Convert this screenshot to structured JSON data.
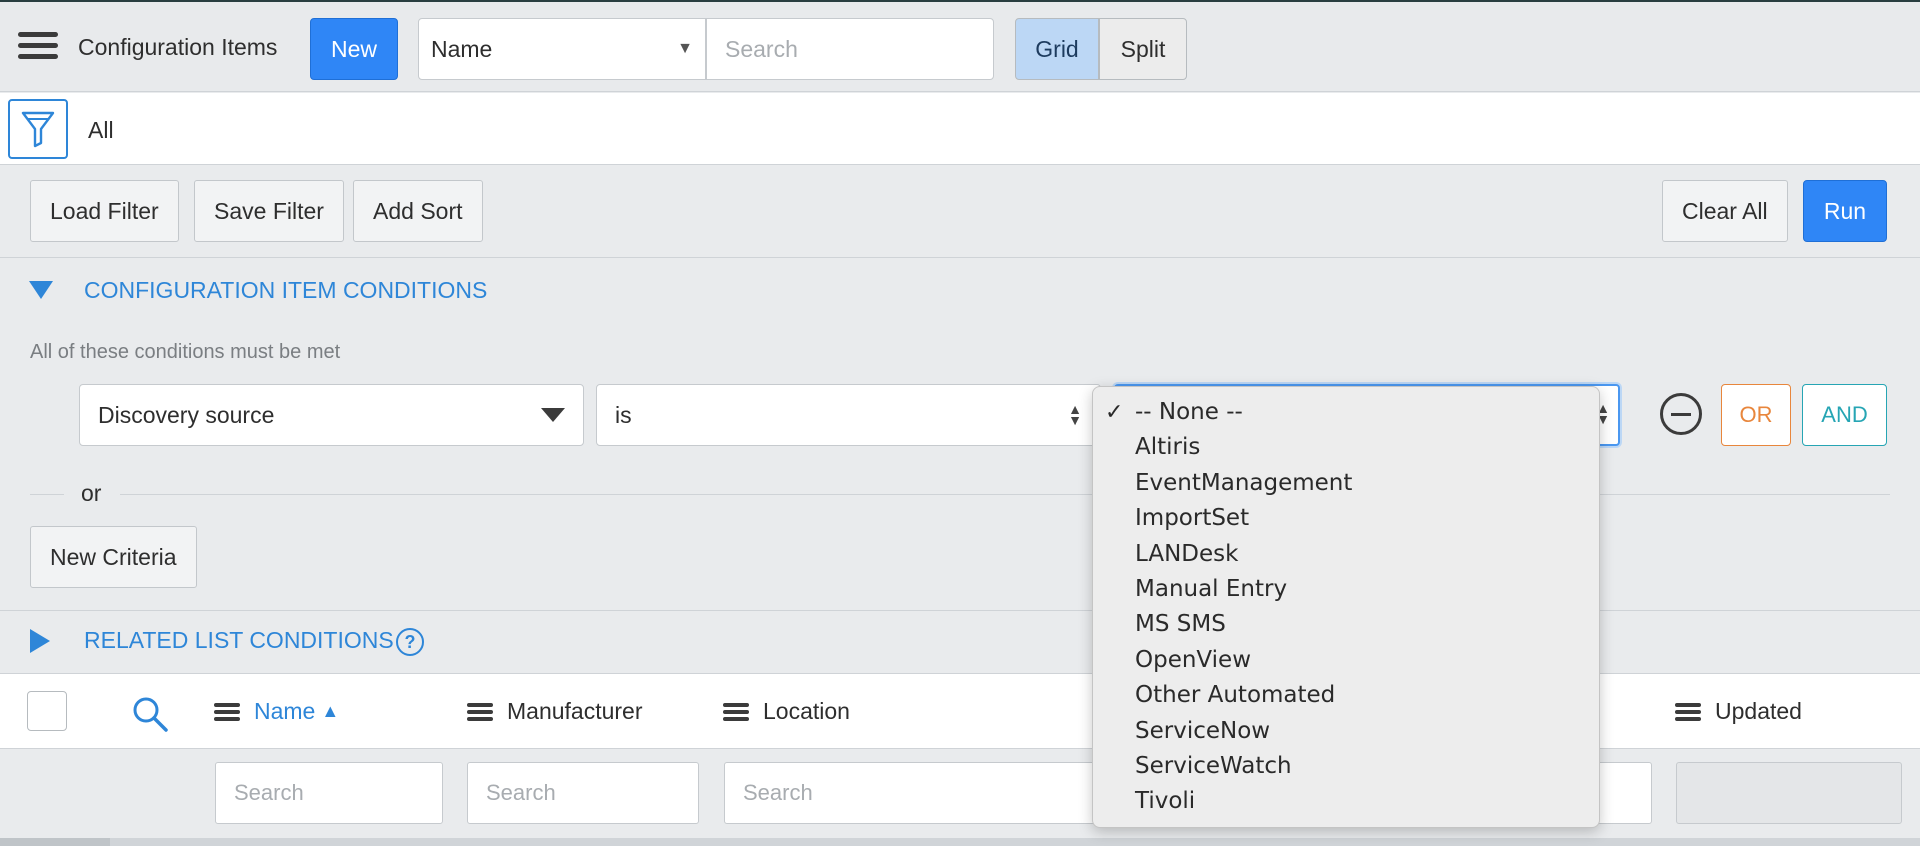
{
  "header": {
    "title": "Configuration Items",
    "new_label": "New",
    "search_field": "Name",
    "search_placeholder": "Search",
    "view_grid": "Grid",
    "view_split": "Split"
  },
  "breadcrumb": "All",
  "actions": {
    "load_filter": "Load Filter",
    "save_filter": "Save Filter",
    "add_sort": "Add Sort",
    "clear_all": "Clear All",
    "run": "Run"
  },
  "conditions": {
    "title": "CONFIGURATION ITEM CONDITIONS",
    "note": "All of these conditions must be met",
    "field": "Discovery source",
    "operator": "is",
    "or_btn": "OR",
    "and_btn": "AND",
    "or_separator": "or",
    "new_criteria": "New Criteria"
  },
  "related": {
    "title": "RELATED LIST CONDITIONS",
    "help": "?"
  },
  "table": {
    "sort_indicator": "▲",
    "columns": [
      "Name",
      "Manufacturer",
      "Location",
      "Updated"
    ],
    "search_placeholder": "Search"
  },
  "dropdown": {
    "check": "✓",
    "options": [
      "-- None --",
      "Altiris",
      "EventManagement",
      "ImportSet",
      "LANDesk",
      "Manual Entry",
      "MS SMS",
      "OpenView",
      "Other Automated",
      "ServiceNow",
      "ServiceWatch",
      "Tivoli"
    ],
    "selected": "-- None --"
  },
  "colors": {
    "primary": "#2f86f6",
    "link": "#2e86d8",
    "or": "#e8863c",
    "and": "#26a5b4"
  }
}
